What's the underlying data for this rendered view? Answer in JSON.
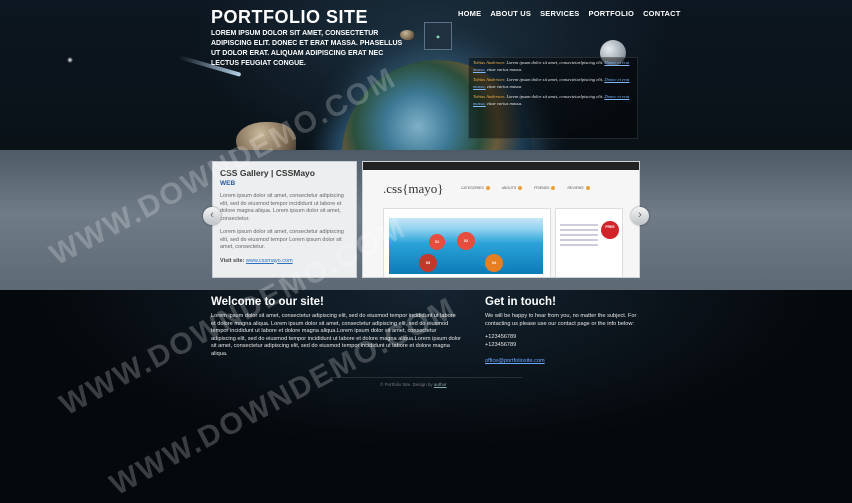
{
  "header": {
    "logo": "PORTFOLIO SITE",
    "tagline": "LOREM IPSUM DOLOR SIT AMET, CONSECTETUR ADIPISCING ELIT. DONEC ET ERAT MASSA. PHASELLUS UT DOLOR ERAT. ALIQUAM ADIPISCING ERAT NEC LECTUS FEUGIAT CONGUE.",
    "nav": [
      "HOME",
      "ABOUT US",
      "SERVICES",
      "PORTFOLIO",
      "CONTACT"
    ]
  },
  "tweets": [
    {
      "author": "Tobias Anderson:",
      "text": "Lorem ipsum dolor sit amet, consecteturlpiscing elit.",
      "link": "Donec et erat massa,",
      "rest": "vitae varius massa."
    },
    {
      "author": "Tobias Anderson:",
      "text": "Lorem ipsum dolor sit amet, consecteturlpiscing elit.",
      "link": "Donec et erat massa,",
      "rest": "vitae varius massa."
    },
    {
      "author": "Tobias Anderson:",
      "text": "Lorem ipsum dolor sit amet, consecteturlpiscing elit.",
      "link": "Donec et erat massa,",
      "rest": "vitae varius massa."
    }
  ],
  "slider": {
    "title": "CSS Gallery | CSSMayo",
    "category": "WEB",
    "para1": "Lorem ipsum dolor sit amet, consectetur adipiscing elit, sed do eiusmod tempor incididunt ut labore et dolore magna aliqua. Lorem ipsum dolor sit amet, consectetur.",
    "para2": "Lorem ipsum dolor sit amet, consectetur adipiscing elit, sed do eiusmod tempor Lorem ipsum dolor sit amet, consectetur.",
    "visit_label": "Visit site:",
    "visit_link": "www.cssmayo.com",
    "shot_logo": ".css{mayo}",
    "shot_menu": [
      "CATEGORIES",
      "ABOUTS",
      "FRIENDS",
      "REVIEWS"
    ],
    "shot_bubbles": [
      "01",
      "02",
      "03",
      "04"
    ],
    "shot_badge": "FREE"
  },
  "welcome": {
    "title": "Welcome to our site!",
    "body": "Lorem ipsum dolor sit amet, consectetur adipiscing elit, sed do eiusmod tempor incididunt ut labore et dolore magna aliqua. Lorem ipsum dolor sit amet, consectetur adipiscing elit, sed do eiusmod tempor incididunt ut labore et dolore magna aliqua.Lorem ipsum dolor sit amet, consectetur adipiscing elit, sed do eiusmod tempor incididunt ut labore et dolore magna aliqua.Lorem ipsum dolor sit amet, consectetur adipiscing elit, sed do eiusmod tempor incididunt ut labore et dolore magna aliqua."
  },
  "contact": {
    "title": "Get in touch!",
    "body": "We will be happy to hear from you, no matter the subject. For contacting us please use our contact page or the info below:",
    "phone1": "+123456789",
    "phone2": "+123456789",
    "email": "office@portfoliosite.com"
  },
  "footer": {
    "text": "© Portfolio Site. Design by",
    "link": "author"
  },
  "watermark": [
    "WWW.DOWNDEMO.COM",
    "WWW.DOWNDEMO.COM",
    "WWW.DOWNDEMO.COM"
  ]
}
